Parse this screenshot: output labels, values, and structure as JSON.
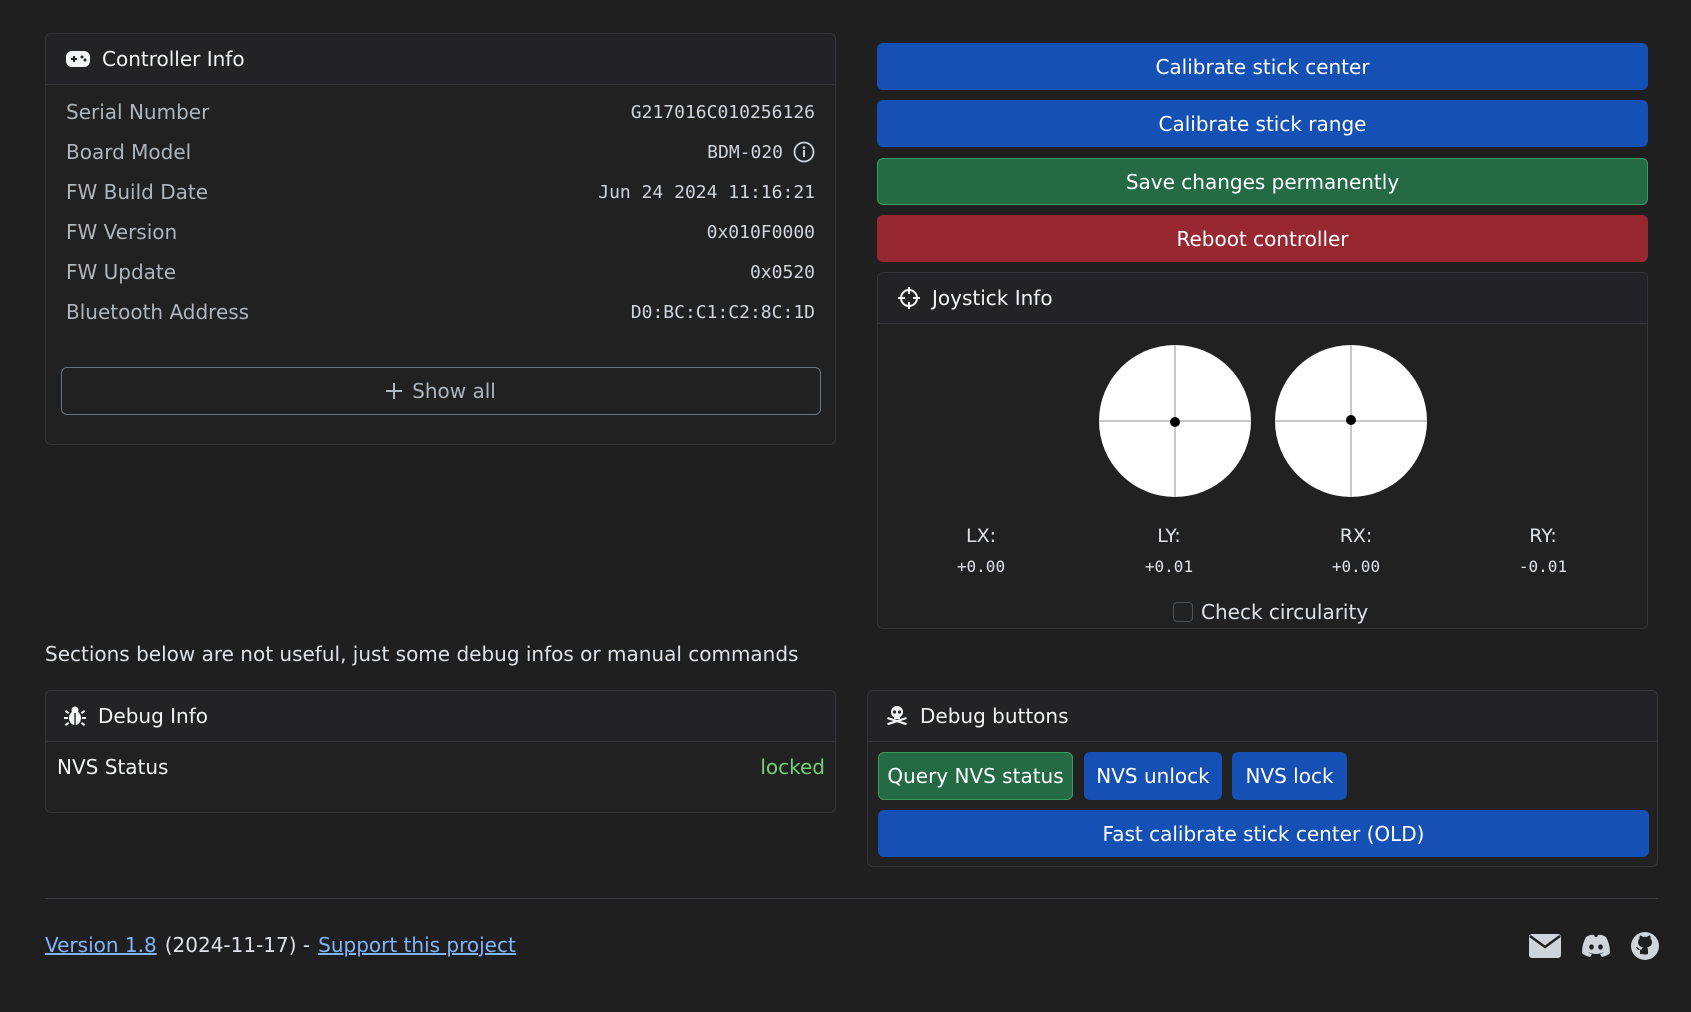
{
  "controller_info": {
    "title": "Controller Info",
    "rows": [
      {
        "label": "Serial Number",
        "value": "G217016C010256126"
      },
      {
        "label": "Board Model",
        "value": "BDM-020"
      },
      {
        "label": "FW Build Date",
        "value": "Jun 24 2024 11:16:21"
      },
      {
        "label": "FW Version",
        "value": "0x010F0000"
      },
      {
        "label": "FW Update",
        "value": "0x0520"
      },
      {
        "label": "Bluetooth Address",
        "value": "D0:BC:C1:C2:8C:1D"
      }
    ],
    "show_all_label": "Show all"
  },
  "actions": {
    "calibrate_center": "Calibrate stick center",
    "calibrate_range": "Calibrate stick range",
    "save_changes": "Save changes permanently",
    "reboot": "Reboot controller"
  },
  "joystick_info": {
    "title": "Joystick Info",
    "axes": [
      {
        "label": "LX:",
        "value": "+0.00"
      },
      {
        "label": "LY:",
        "value": "+0.01"
      },
      {
        "label": "RX:",
        "value": "+0.00"
      },
      {
        "label": "RY:",
        "value": "-0.01"
      }
    ],
    "check_circularity_label": "Check circularity",
    "check_circularity_checked": false
  },
  "debug_note": "Sections below are not useful, just some debug infos or manual commands",
  "debug_info": {
    "title": "Debug Info",
    "nvs_label": "NVS Status",
    "nvs_value": "locked",
    "nvs_color": "#75d07a"
  },
  "debug_buttons": {
    "title": "Debug buttons",
    "query_nvs": "Query NVS status",
    "nvs_unlock": "NVS unlock",
    "nvs_lock": "NVS lock",
    "fast_calibrate": "Fast calibrate stick center (OLD)"
  },
  "footer": {
    "version_link": "Version 1.8",
    "date_text": "(2024-11-17) -",
    "support_link": "Support this project",
    "icons": [
      "envelope-icon",
      "discord-icon",
      "github-icon"
    ]
  },
  "colors": {
    "background": "#1f1f20",
    "primary": "#1550b4",
    "success": "#246b45",
    "danger": "#972731",
    "link": "#7fb4ff"
  }
}
